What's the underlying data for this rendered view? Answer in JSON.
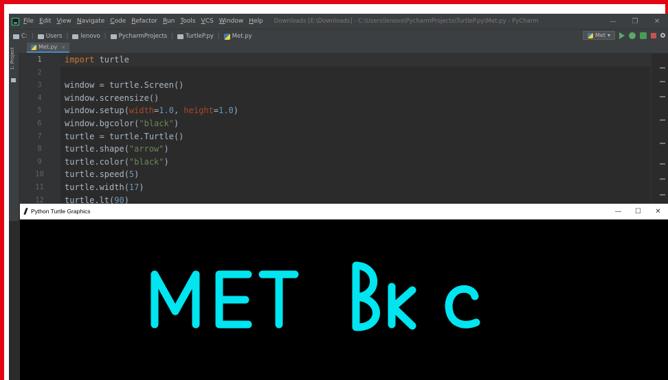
{
  "ide": {
    "menu": [
      "File",
      "Edit",
      "View",
      "Navigate",
      "Code",
      "Refactor",
      "Run",
      "Tools",
      "VCS",
      "Window",
      "Help"
    ],
    "title": "Downloads [E:\\Downloads] - C:\\Users\\lenovo\\PycharmProjects\\TurtleP.py\\Met.py - PyCharm",
    "window_controls": [
      "—",
      "❐",
      "✕"
    ]
  },
  "navbar": {
    "crumbs": [
      "C:",
      "Users",
      "lenovo",
      "PycharmProjects",
      "TurtleP.py",
      "Met.py"
    ],
    "run_config": "Met"
  },
  "sidebar": {
    "project_label": "1: Project"
  },
  "tab": {
    "label": "Met.py",
    "close": "×"
  },
  "editor": {
    "line_numbers": [
      "1",
      "2",
      "3",
      "4",
      "5",
      "6",
      "7",
      "8",
      "9",
      "10",
      "11",
      "12"
    ],
    "lines": [
      [
        {
          "t": "kw",
          "v": "import"
        },
        {
          "t": "plain",
          "v": " turtle"
        }
      ],
      [],
      [
        {
          "t": "plain",
          "v": "window = turtle.Screen()"
        }
      ],
      [
        {
          "t": "plain",
          "v": "window.screensize()"
        }
      ],
      [
        {
          "t": "plain",
          "v": "window.setup("
        },
        {
          "t": "param",
          "v": "width"
        },
        {
          "t": "plain",
          "v": "="
        },
        {
          "t": "num",
          "v": "1.0"
        },
        {
          "t": "plain",
          "v": ", "
        },
        {
          "t": "param",
          "v": "height"
        },
        {
          "t": "plain",
          "v": "="
        },
        {
          "t": "num",
          "v": "1.0"
        },
        {
          "t": "plain",
          "v": ")"
        }
      ],
      [
        {
          "t": "plain",
          "v": "window.bgcolor("
        },
        {
          "t": "str",
          "v": "\"black\""
        },
        {
          "t": "plain",
          "v": ")"
        }
      ],
      [
        {
          "t": "plain",
          "v": "turtle = turtle.Turtle()"
        }
      ],
      [
        {
          "t": "plain",
          "v": "turtle.shape("
        },
        {
          "t": "str",
          "v": "\"arrow\""
        },
        {
          "t": "plain",
          "v": ")"
        }
      ],
      [
        {
          "t": "plain",
          "v": "turtle.color("
        },
        {
          "t": "str",
          "v": "\"black\""
        },
        {
          "t": "plain",
          "v": ")"
        }
      ],
      [
        {
          "t": "plain",
          "v": "turtle.speed("
        },
        {
          "t": "num",
          "v": "5"
        },
        {
          "t": "plain",
          "v": ")"
        }
      ],
      [
        {
          "t": "plain",
          "v": "turtle.width("
        },
        {
          "t": "num",
          "v": "17"
        },
        {
          "t": "plain",
          "v": ")"
        }
      ],
      [
        {
          "t": "plain",
          "v": "turtle.lt("
        },
        {
          "t": "num",
          "v": "90"
        },
        {
          "t": "plain",
          "v": ")"
        }
      ]
    ]
  },
  "turtle_window": {
    "title": "Python Turtle Graphics",
    "controls": [
      "—",
      "☐",
      "✕"
    ],
    "drawing_text": "MET BKC",
    "stroke_color": "#00e5ef",
    "background_color": "#000000"
  },
  "colors": {
    "frame": "#e30613",
    "keyword": "#cc7832",
    "param": "#aa4926",
    "number": "#6897bb",
    "string": "#6a8759"
  }
}
